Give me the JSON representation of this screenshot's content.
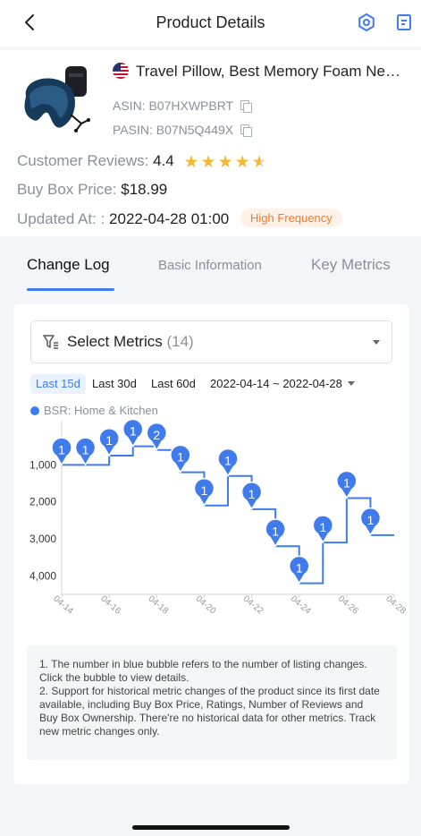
{
  "header": {
    "title": "Product Details"
  },
  "product": {
    "title": "Travel Pillow, Best Memory Foam Neck Pillow",
    "asin": "ASIN: B07HXWPBRT",
    "pasin": "PASIN: B07N5Q449X",
    "reviews_label": "Customer Reviews:",
    "reviews_value": "4.4",
    "rating": 4.4,
    "price_label": "Buy Box Price:",
    "price_value": "$18.99",
    "updated_label": "Updated At: :",
    "updated_value": "2022-04-28 01:00",
    "frequency_badge": "High Frequency"
  },
  "tabs": [
    {
      "label": "Change Log",
      "active": true
    },
    {
      "label": "Basic Information",
      "active": false
    },
    {
      "label": "Key Metrics",
      "active": false
    }
  ],
  "filters": {
    "select_label": "Select Metrics",
    "select_count": "(14)",
    "ranges": [
      "Last 15d",
      "Last 30d",
      "Last 60d"
    ],
    "active_range": "Last 15d",
    "date_range": "2022-04-14 ~ 2022-04-28"
  },
  "legend": {
    "label": "BSR: Home & Kitchen"
  },
  "chart_data": {
    "type": "line",
    "step": true,
    "series": [
      {
        "name": "BSR: Home & Kitchen",
        "x": [
          "04-14",
          "04-15",
          "04-16",
          "04-17",
          "04-18",
          "04-19",
          "04-20",
          "04-21",
          "04-22",
          "04-23",
          "04-24",
          "04-25",
          "04-26",
          "04-27",
          "04-28"
        ],
        "values": [
          1000,
          1000,
          750,
          500,
          600,
          1200,
          2100,
          1300,
          2200,
          3200,
          4200,
          3100,
          1900,
          2900,
          2900
        ],
        "bubbles": [
          1,
          1,
          1,
          1,
          2,
          1,
          1,
          1,
          1,
          1,
          1,
          1,
          1,
          1,
          null
        ]
      }
    ],
    "x_ticks": [
      "04-14",
      "04-16",
      "04-18",
      "04-20",
      "04-22",
      "04-24",
      "04-26",
      "04-28"
    ],
    "y_ticks": [
      "1,000",
      "2,000",
      "3,000",
      "4,000"
    ],
    "y_tick_values": [
      1000,
      2000,
      3000,
      4000
    ],
    "y_inverted": true,
    "ylim": [
      0,
      4500
    ],
    "color": "#3f7bea"
  },
  "notes": {
    "line1": "1. The number in blue bubble refers to the number of listing changes. Click the bubble to view details.",
    "line2": "2. Support for historical metric changes of the product since its first date available, including Buy Box Price, Ratings, Number of Reviews and Buy Box Ownership. There're no historical data for other metrics. Track new metric changes only."
  },
  "colors": {
    "accent": "#3f7bea",
    "star": "#f5b82e",
    "badge_text": "#f07a2b"
  },
  "icons": {
    "back": "chevron-left-icon",
    "settings": "settings-icon",
    "notes": "document-icon",
    "filter": "filter-icon"
  }
}
